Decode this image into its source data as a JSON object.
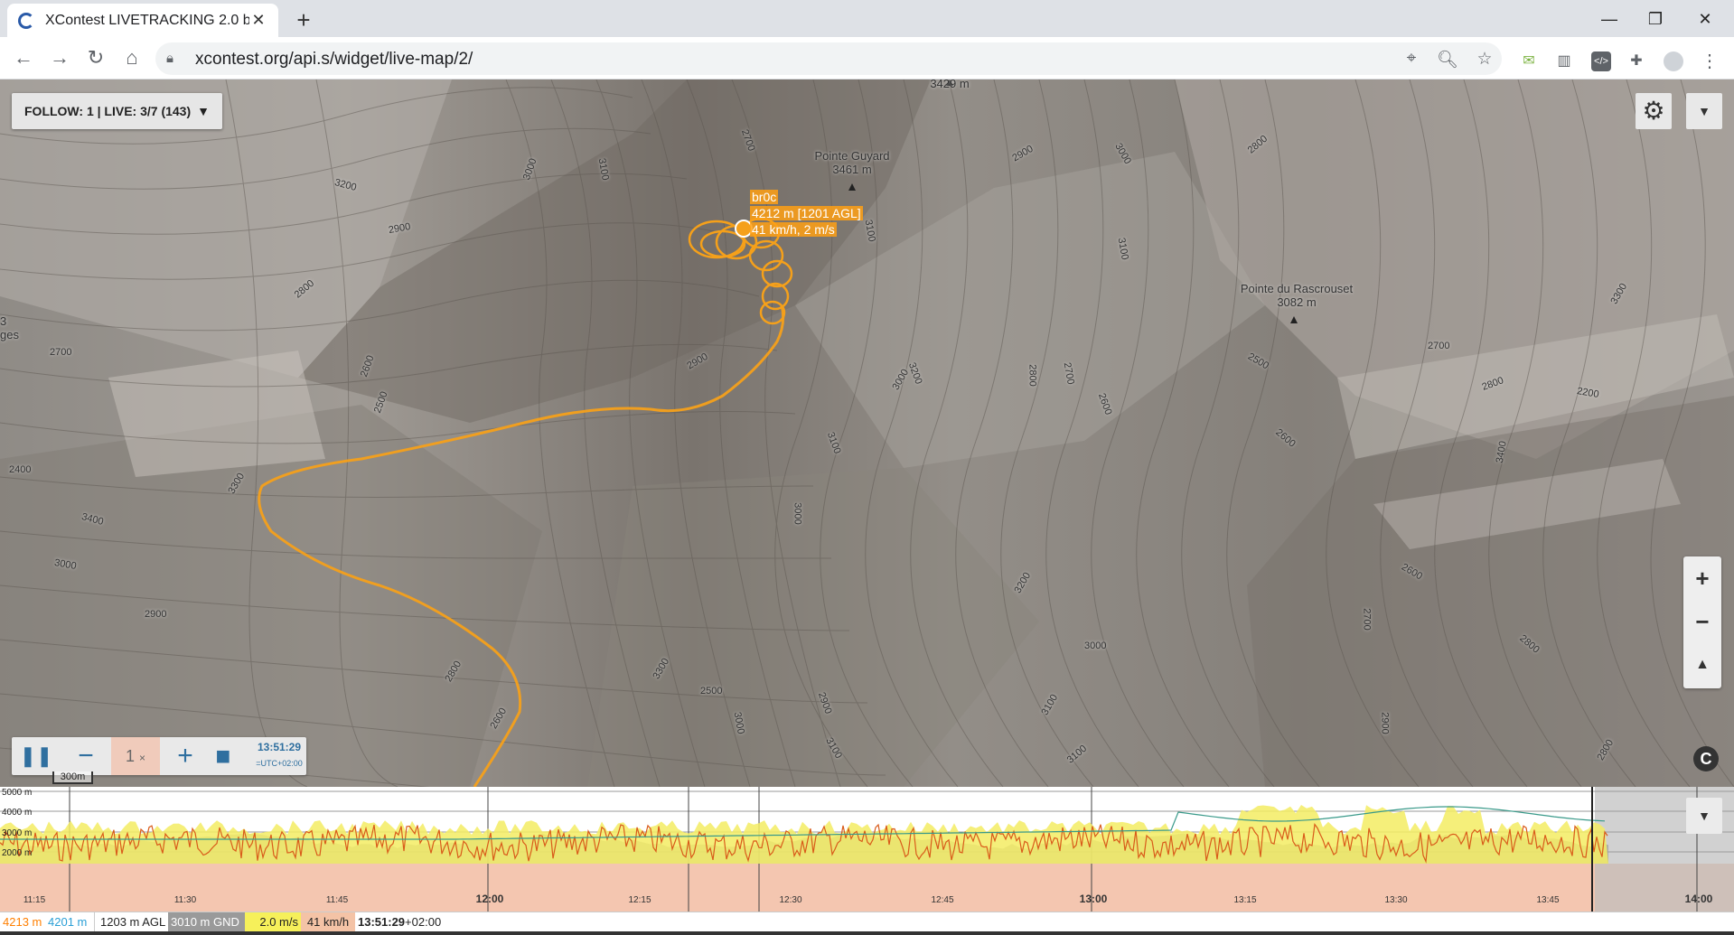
{
  "browser": {
    "tab_title": "XContest LIVETRACKING 2.0 beta",
    "tab_close": "✕",
    "new_tab": "+",
    "url": "xcontest.org/api.s/widget/live-map/2/",
    "win_min": "—",
    "win_restore": "❐",
    "win_close": "✕"
  },
  "map": {
    "follow_label": "FOLLOW: 1 | LIVE: 3/7 (143)",
    "follow_arrow": "▼",
    "menu_arrow": "▼",
    "zoom_in": "+",
    "zoom_out": "−",
    "north": "▲",
    "copyright": "C",
    "scale": "300m",
    "peaks": [
      {
        "name": "",
        "elev": "3429 m"
      },
      {
        "name": "Pointe Guyard",
        "elev": "3461 m"
      },
      {
        "name": "Pointe du Rascrouset",
        "elev": "3082 m"
      }
    ],
    "contour_labels": [
      "3000",
      "3100",
      "3200",
      "2900",
      "2800",
      "2700",
      "2600",
      "2500",
      "2400",
      "3300",
      "3400",
      "3000",
      "2900",
      "2800",
      "2600",
      "2700",
      "3100",
      "3000",
      "2900",
      "2800",
      "3100",
      "3000",
      "3200",
      "3100",
      "3000",
      "2900",
      "2800",
      "2700",
      "2600",
      "2500",
      "2600",
      "2700",
      "2800",
      "3400",
      "3300",
      "2200",
      "2600",
      "2700",
      "2800",
      "2900",
      "3000",
      "3100",
      "3200",
      "3300",
      "2500",
      "3000",
      "2900",
      "3100",
      "3100",
      "2800"
    ],
    "partial_labels": [
      "ges",
      "3"
    ],
    "pilot": {
      "name": "br0c",
      "altitude": "4212 m [1201 AGL]",
      "speed": "41 km/h, 2 m/s"
    }
  },
  "player": {
    "pause": "❚❚",
    "minus": "−",
    "speed": "1",
    "speed_unit": "×",
    "plus": "+",
    "stop": "■",
    "time": "13:51:29",
    "tz": "=UTC+02:00"
  },
  "barogram": {
    "menu_arrow": "▼",
    "y_labels": [
      "5000 m",
      "4000 m",
      "3000 m",
      "2000 m"
    ],
    "x_labels": [
      "11:15",
      "11:30",
      "11:45",
      "12:00",
      "12:15",
      "12:30",
      "12:45",
      "13:00",
      "13:15",
      "13:30",
      "13:45",
      "14:00"
    ],
    "x_bold": [
      false,
      false,
      false,
      true,
      false,
      false,
      false,
      true,
      false,
      false,
      false,
      true
    ]
  },
  "status": {
    "alt_gps": "4213 m",
    "alt_baro": "4201 m",
    "agl": "1203 m AGL",
    "gnd": "3010 m GND",
    "vario": "2.0 m/s",
    "speed": "41 km/h",
    "time": "13:51:29",
    "tz": "+02:00"
  },
  "colors": {
    "track": "#f5a01a",
    "status_orange": "#ff7f00",
    "status_blue": "#2a9fd6",
    "vario_bg": "#f6f05a",
    "speed_bg": "#f4c3a6",
    "gnd_bg": "#9a9a9a"
  }
}
